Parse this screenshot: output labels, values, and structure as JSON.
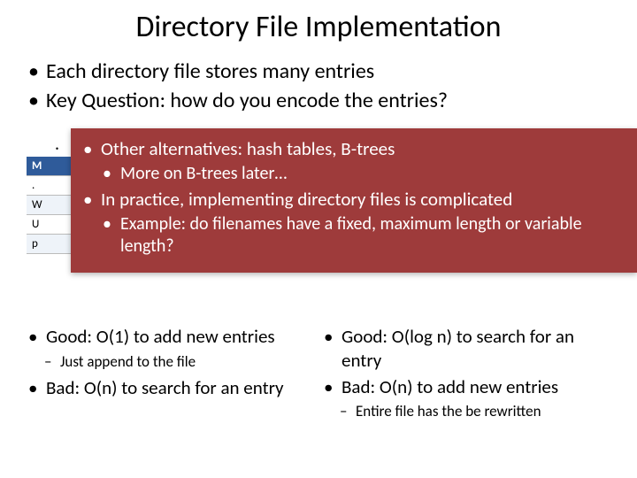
{
  "title": "Directory File Implementation",
  "top_bullets": [
    "Each directory file stores many entries",
    "Key Question: how do you encode the entries?"
  ],
  "table_peek": {
    "header": "M",
    "rows": [
      ".",
      "W",
      "U",
      "p"
    ]
  },
  "overlay": {
    "b1a": "Other alternatives: hash tables, B-trees",
    "b2a": "More on B-trees later…",
    "b1b": "In practice, implementing directory files is complicated",
    "b2b": "Example: do filenames have a fixed, maximum length or variable length?"
  },
  "left_col": {
    "b1a": "Good: O(1) to add new entries",
    "b2a": "Just append to the file",
    "b1b": "Bad: O(n) to search for an entry"
  },
  "right_col": {
    "b1a": "Good: O(log n) to search for an entry",
    "b1b": "Bad: O(n) to add new entries",
    "b2b": "Entire file has the be rewritten"
  }
}
